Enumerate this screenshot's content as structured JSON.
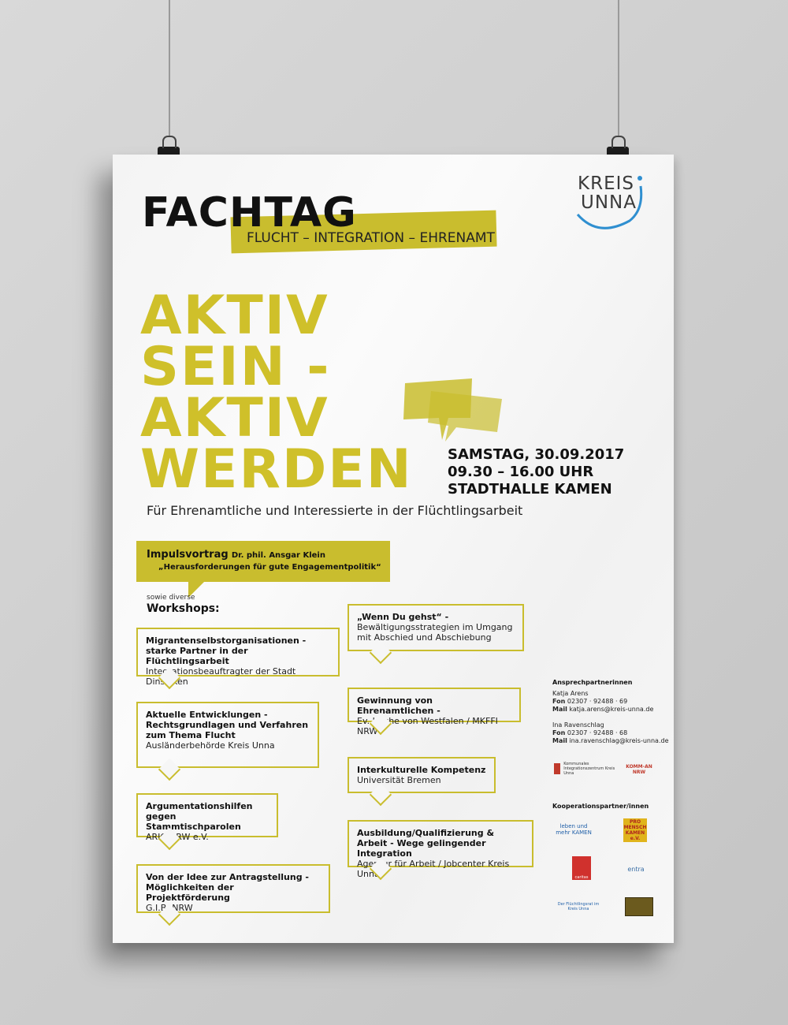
{
  "poster": {
    "title": "FACHTAG",
    "subtitle": "FLUCHT – INTEGRATION – EHRENAMT",
    "logo_line1": "KREIS",
    "logo_line2": "UNNA",
    "headline": [
      "AKTIV",
      "SEIN -",
      "AKTIV",
      "WERDEN"
    ],
    "date": "SAMSTAG, 30.09.2017",
    "time": "09.30 – 16.00 UHR",
    "venue": "STADTHALLE KAMEN",
    "lead": "Für Ehrenamtliche und Interessierte in der Flüchtlingsarbeit",
    "impuls_label": "Impulsvortrag",
    "impuls_speaker": "Dr. phil. Ansgar Klein",
    "impuls_topic": "„Herausforderungen für gute Engagementpolitik“",
    "sowie": "sowie diverse",
    "workshops_label": "Workshops:",
    "workshops": [
      {
        "title": "Migrantenselbstorganisationen - starke Partner in der Flüchtlingsarbeit",
        "sub": "Integrationsbeauftragter der Stadt Dinslaken"
      },
      {
        "title": "Aktuelle Entwicklungen - Rechtsgrundlagen und Verfahren zum Thema Flucht",
        "sub": "Ausländerbehörde Kreis Unna"
      },
      {
        "title": "Argumentationshilfen gegen Stammtischparolen",
        "sub": "ARIC-NRW e.V."
      },
      {
        "title": "Von der Idee zur Antragstellung - Möglichkeiten der Projektförderung",
        "sub": "G.I.B. NRW"
      },
      {
        "title": "„Wenn Du gehst“ -",
        "sub": "Bewältigungsstrategien im Umgang mit Abschied und Abschiebung"
      },
      {
        "title": "Gewinnung von Ehrenamtlichen -",
        "sub": "Ev. Kirche von Westfalen / MKFFI NRW"
      },
      {
        "title": "Interkulturelle Kompetenz",
        "sub": "Universität Bremen"
      },
      {
        "title": "Ausbildung/Qualifizierung & Arbeit - Wege gelingender Integration",
        "sub": "Agentur für Arbeit / Jobcenter Kreis Unna"
      }
    ],
    "contacts_heading": "Ansprechpartnerinnen",
    "contacts": [
      {
        "name": "Katja Arens",
        "fon_label": "Fon",
        "fon": "02307 · 92488 · 69",
        "mail_label": "Mail",
        "mail": "katja.arens@kreis-unna.de"
      },
      {
        "name": "Ina Ravenschlag",
        "fon_label": "Fon",
        "fon": "02307 · 92488 · 68",
        "mail_label": "Mail",
        "mail": "ina.ravenschlag@kreis-unna.de"
      }
    ],
    "partners_heading": "Kooperationspartner/innen",
    "ki_logo": "Kommunales Integrationszentrum Kreis Unna",
    "komm_logo": "KOMM-AN NRW",
    "kamen_logo": "leben und mehr KAMEN",
    "pro_logo": "PRO MENSCH KAMEN e.V.",
    "caritas_logo": "caritas",
    "entra_logo": "entra",
    "fluecht_logo": "Der Flüchtlingsrat im Kreis Unna"
  },
  "colors": {
    "accent": "#c9bd2e",
    "headline": "#cfc02a",
    "logo_ring": "#2f8fd0"
  }
}
